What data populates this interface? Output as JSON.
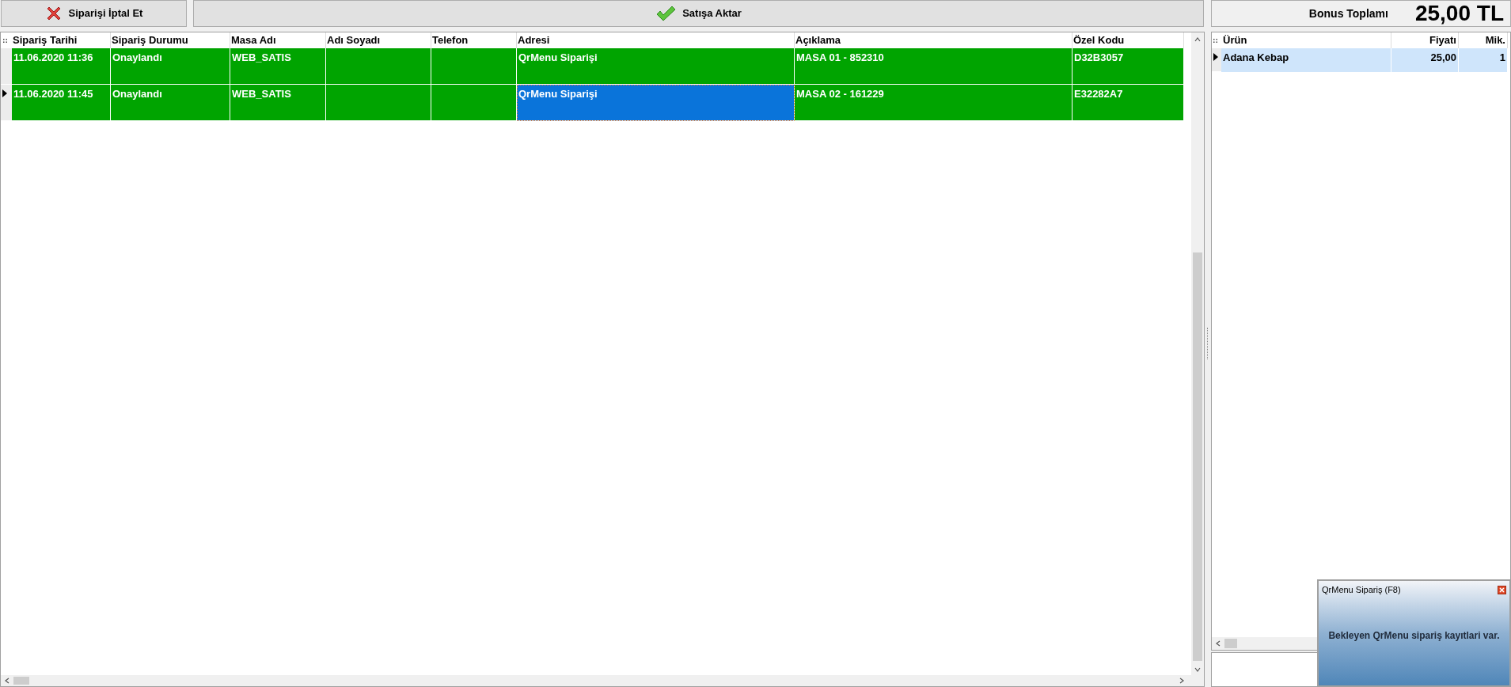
{
  "toolbar": {
    "buttons": [
      {
        "kind": "cancel",
        "label": "Siparişi İptal Et"
      },
      {
        "kind": "confirm",
        "label": "Satışa Aktar"
      }
    ]
  },
  "orders": {
    "columns": [
      "Sipariş Tarihi",
      "Sipariş Durumu",
      "Masa Adı",
      "Adı Soyadı",
      "Telefon",
      "Adresi",
      "Açıklama",
      "Özel Kodu"
    ],
    "rows": [
      {
        "selected": false,
        "cells": [
          {
            "text": "11.06.2020 11:36",
            "focused": false
          },
          {
            "text": "Onaylandı",
            "focused": false
          },
          {
            "text": "WEB_SATIS",
            "focused": false
          },
          {
            "focused": false
          },
          {
            "focused": false
          },
          {
            "text": "QrMenu Siparişi",
            "focused": false
          },
          {
            "text": "MASA 01 - 852310",
            "focused": false
          },
          {
            "text": "D32B3057",
            "focused": false
          }
        ]
      },
      {
        "selected": true,
        "cells": [
          {
            "text": "11.06.2020 11:45",
            "focused": false
          },
          {
            "text": "Onaylandı",
            "focused": false
          },
          {
            "text": "WEB_SATIS",
            "focused": false
          },
          {
            "focused": false
          },
          {
            "focused": false
          },
          {
            "text": "QrMenu Siparişi",
            "focused": true
          },
          {
            "text": "MASA 02 - 161229",
            "focused": false
          },
          {
            "text": "E32282A7",
            "focused": false
          }
        ]
      }
    ]
  },
  "bonus": {
    "label": "Bonus Toplamı",
    "value": "25,00 TL"
  },
  "items": {
    "columns": [
      "Ürün",
      "Fiyatı",
      "Mik."
    ],
    "rows": [
      {
        "selected": true,
        "cells": [
          "Adana Kebap",
          "25,00",
          "1"
        ]
      }
    ]
  },
  "notification": {
    "title": "QrMenu Sipariş (F8)",
    "message": "Bekleyen QrMenu sipariş kayıtlari var."
  }
}
